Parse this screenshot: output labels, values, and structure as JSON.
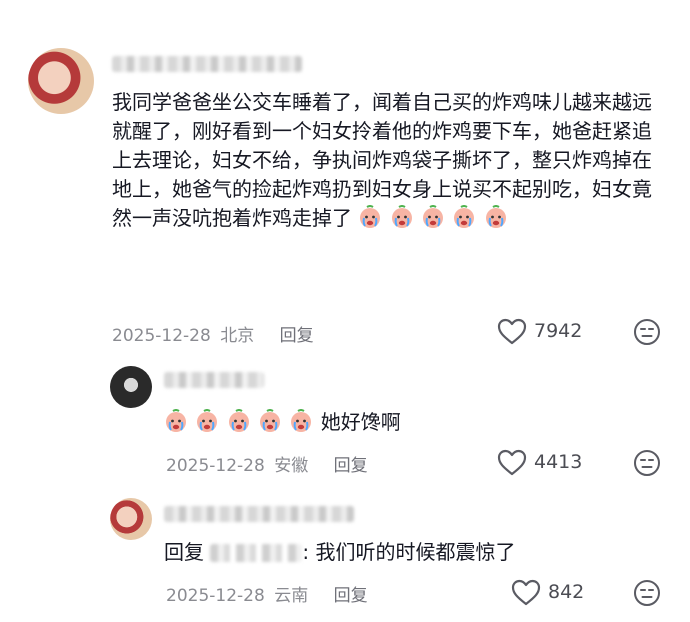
{
  "comments": [
    {
      "name": "",
      "text": "我同学爸爸坐公交车睡着了，闻着自己买的炸鸡味儿越来越远就醒了，刚好看到一个妇女拎着他的炸鸡要下车，她爸赶紧追上去理论，妇女不给，争执间炸鸡袋子撕坏了，整只炸鸡掉在地上，她爸气的捡起炸鸡扔到妇女身上说买不起别吃，妇女竟然一声没吭抱着炸鸡走掉了",
      "emoji_icon": "crying-face-sticker",
      "date": "2025-12-28",
      "location": "北京",
      "reply_label": "回复",
      "likes": "7942"
    },
    {
      "name": "",
      "text": "她好馋啊",
      "emoji_icon": "crying-face-sticker",
      "date": "2025-12-28",
      "location": "安徽",
      "reply_label": "回复",
      "likes": "4413"
    },
    {
      "name": "",
      "reply_prefix": "回复",
      "text": ": 我们听的时候都震惊了",
      "date": "2025-12-28",
      "location": "云南",
      "reply_label": "回复",
      "likes": "842"
    }
  ],
  "colors": {
    "text": "#161823",
    "meta": "#8a8b91",
    "icon": "#5a5b63",
    "background": "#ffffff"
  }
}
